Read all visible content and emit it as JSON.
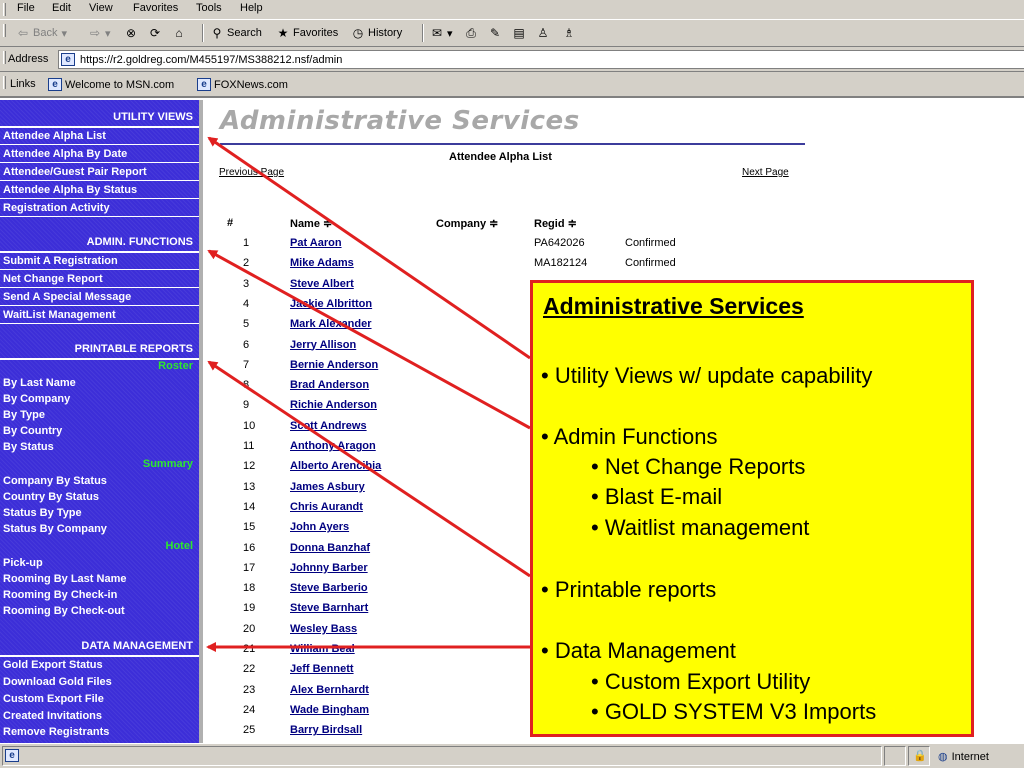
{
  "menu": {
    "file": "File",
    "edit": "Edit",
    "view": "View",
    "favorites": "Favorites",
    "tools": "Tools",
    "help": "Help"
  },
  "toolbar": {
    "back": "Back",
    "search": "Search",
    "favorites": "Favorites",
    "history": "History"
  },
  "address": {
    "label": "Address",
    "url": "https://r2.goldreg.com/M455197/MS388212.nsf/admin"
  },
  "links": {
    "label": "Links",
    "items": [
      "Welcome to MSN.com",
      "FOXNews.com"
    ]
  },
  "sidebar": {
    "utility_views": {
      "heading": "UTILITY VIEWS",
      "items": [
        "Attendee Alpha List",
        "Attendee Alpha By Date",
        "Attendee/Guest Pair Report",
        "Attendee Alpha By Status",
        "Registration Activity"
      ]
    },
    "admin_functions": {
      "heading": "ADMIN. FUNCTIONS",
      "items": [
        "Submit A Registration",
        "Net Change Report",
        "Send A Special Message",
        "WaitList Management"
      ]
    },
    "printable_reports": {
      "heading": "PRINTABLE REPORTS",
      "roster_label": "Roster",
      "roster": [
        "By Last Name",
        "By Company",
        "By Type",
        "By Country",
        "By Status"
      ],
      "summary_label": "Summary",
      "summary": [
        "Company By Status",
        "Country By Status",
        "Status By Type",
        "Status By Company"
      ],
      "hotel_label": "Hotel",
      "hotel": [
        "Pick-up",
        "Rooming By Last Name",
        "Rooming By Check-in",
        "Rooming By Check-out"
      ]
    },
    "data_management": {
      "heading": "DATA MANAGEMENT",
      "items": [
        "Gold Export Status",
        "Download Gold Files",
        "Custom Export File",
        "Created Invitations",
        "Remove Registrants"
      ]
    }
  },
  "main": {
    "title": "Administrative Services",
    "list_title": "Attendee Alpha List",
    "prev": "Previous Page",
    "next": "Next Page",
    "columns": {
      "num": "#",
      "name": "Name ≑",
      "company": "Company ≑",
      "regid": "Regid ≑"
    },
    "rows": [
      {
        "num": "1",
        "name": "Pat Aaron",
        "regid": "PA642026",
        "status": "Confirmed"
      },
      {
        "num": "2",
        "name": "Mike Adams",
        "regid": "MA182124",
        "status": "Confirmed"
      },
      {
        "num": "3",
        "name": "Steve Albert",
        "regid": "",
        "status": ""
      },
      {
        "num": "4",
        "name": "Jackie Albritton",
        "regid": "",
        "status": ""
      },
      {
        "num": "5",
        "name": "Mark Alexander",
        "regid": "",
        "status": ""
      },
      {
        "num": "6",
        "name": "Jerry Allison",
        "regid": "",
        "status": ""
      },
      {
        "num": "7",
        "name": "Bernie Anderson",
        "regid": "",
        "status": ""
      },
      {
        "num": "8",
        "name": "Brad Anderson",
        "regid": "",
        "status": ""
      },
      {
        "num": "9",
        "name": "Richie Anderson",
        "regid": "",
        "status": ""
      },
      {
        "num": "10",
        "name": "Scott Andrews",
        "regid": "",
        "status": ""
      },
      {
        "num": "11",
        "name": "Anthony Aragon",
        "regid": "",
        "status": ""
      },
      {
        "num": "12",
        "name": "Alberto Arencibia",
        "regid": "",
        "status": ""
      },
      {
        "num": "13",
        "name": "James Asbury",
        "regid": "",
        "status": ""
      },
      {
        "num": "14",
        "name": "Chris Aurandt",
        "regid": "",
        "status": ""
      },
      {
        "num": "15",
        "name": "John Ayers",
        "regid": "",
        "status": ""
      },
      {
        "num": "16",
        "name": "Donna Banzhaf",
        "regid": "",
        "status": ""
      },
      {
        "num": "17",
        "name": "Johnny Barber",
        "regid": "",
        "status": ""
      },
      {
        "num": "18",
        "name": "Steve Barberio",
        "regid": "",
        "status": ""
      },
      {
        "num": "19",
        "name": "Steve Barnhart",
        "regid": "",
        "status": ""
      },
      {
        "num": "20",
        "name": "Wesley Bass",
        "regid": "",
        "status": ""
      },
      {
        "num": "21",
        "name": "William Beal",
        "regid": "",
        "status": ""
      },
      {
        "num": "22",
        "name": "Jeff Bennett",
        "regid": "",
        "status": ""
      },
      {
        "num": "23",
        "name": "Alex Bernhardt",
        "regid": "",
        "status": ""
      },
      {
        "num": "24",
        "name": "Wade Bingham",
        "regid": "",
        "status": ""
      },
      {
        "num": "25",
        "name": "Barry Birdsall",
        "regid": "",
        "status": ""
      }
    ]
  },
  "callout": {
    "title": "Administrative Services",
    "lines": [
      "• Utility Views w/ update capability",
      "• Admin Functions",
      "• Net Change Reports",
      "• Blast E-mail",
      "• Waitlist management",
      "• Printable reports",
      "• Data Management",
      "• Custom Export Utility",
      "• GOLD SYSTEM V3 Imports"
    ]
  },
  "statusbar": {
    "zone": "Internet"
  },
  "colors": {
    "sidebar": "#3c2ed8",
    "sub_heading": "#2ee82e",
    "callout_bg": "#ffff00",
    "arrow": "#e02020"
  }
}
